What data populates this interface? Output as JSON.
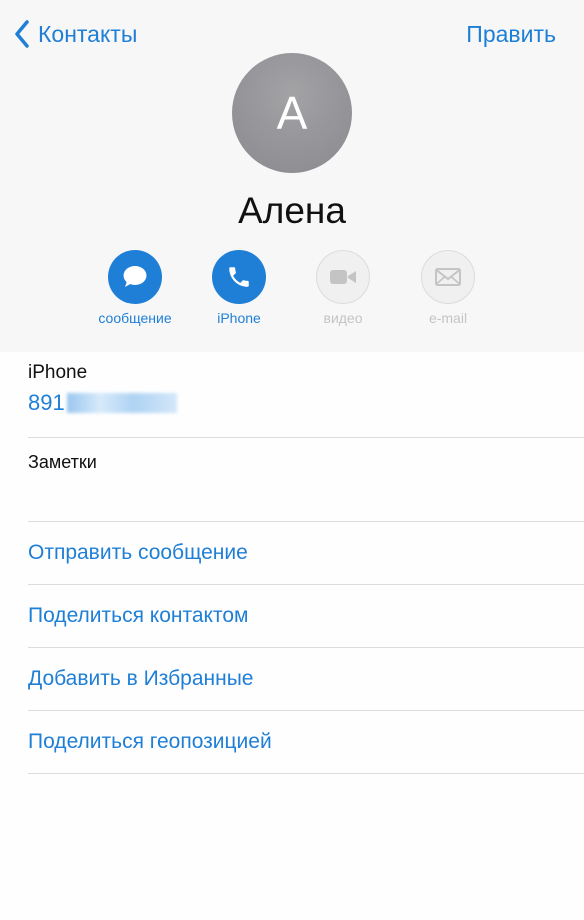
{
  "nav": {
    "back_label": "Контакты",
    "edit_label": "Править"
  },
  "contact": {
    "avatar_initial": "А",
    "name": "Алена"
  },
  "actions": [
    {
      "label": "сообщение",
      "icon": "message-icon",
      "enabled": true
    },
    {
      "label": "iPhone",
      "icon": "phone-icon",
      "enabled": true
    },
    {
      "label": "видео",
      "icon": "video-icon",
      "enabled": false
    },
    {
      "label": "e-mail",
      "icon": "mail-icon",
      "enabled": false
    }
  ],
  "phone": {
    "title": "iPhone",
    "number_visible": "891"
  },
  "notes": {
    "title": "Заметки"
  },
  "links": [
    "Отправить сообщение",
    "Поделиться контактом",
    "Добавить в Избранные",
    "Поделиться геопозицией"
  ],
  "colors": {
    "accent": "#1f7fd6",
    "avatar": "#8e8e93",
    "disabled": "#c4c4c4"
  }
}
